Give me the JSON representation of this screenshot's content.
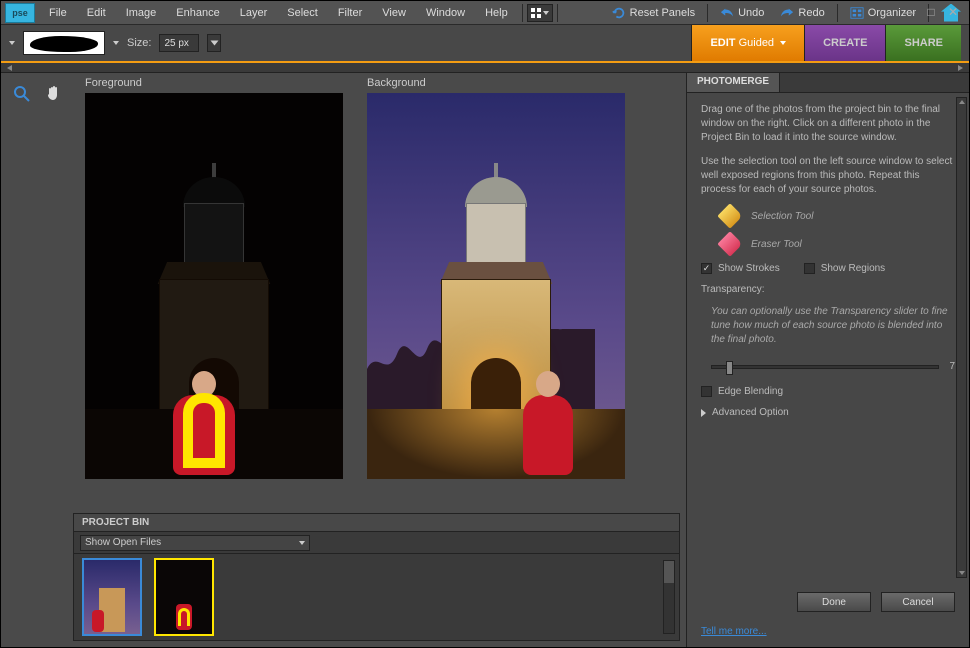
{
  "app": {
    "logo": "pse"
  },
  "menu": [
    "File",
    "Edit",
    "Image",
    "Enhance",
    "Layer",
    "Select",
    "Filter",
    "View",
    "Window",
    "Help"
  ],
  "topbar": {
    "reset": "Reset Panels",
    "undo": "Undo",
    "redo": "Redo",
    "organizer": "Organizer"
  },
  "options": {
    "size_label": "Size:",
    "size_value": "25 px"
  },
  "modes": {
    "edit": "EDIT",
    "guided": "Guided",
    "create": "CREATE",
    "share": "SHARE"
  },
  "workspace": {
    "foreground_label": "Foreground",
    "background_label": "Background"
  },
  "bin": {
    "title": "PROJECT BIN",
    "select": "Show Open Files"
  },
  "panel": {
    "tab": "PHOTOMERGE",
    "instr1": "Drag one of the photos from the project bin to the final window on the right. Click on a different photo in the Project Bin to load it into the source window.",
    "instr2": "Use the selection tool on the left source window to select well exposed regions from this photo. Repeat this process for each of your source photos.",
    "selection_tool": "Selection Tool",
    "eraser_tool": "Eraser Tool",
    "show_strokes": "Show Strokes",
    "show_regions": "Show Regions",
    "transparency_label": "Transparency:",
    "transparency_hint": "You can optionally use the Transparency slider to fine tune how much of each source photo is blended into the final photo.",
    "transparency_value": "7",
    "edge_blending": "Edge Blending",
    "advanced": "Advanced Option",
    "done": "Done",
    "cancel": "Cancel",
    "tell_more": "Tell me more..."
  }
}
